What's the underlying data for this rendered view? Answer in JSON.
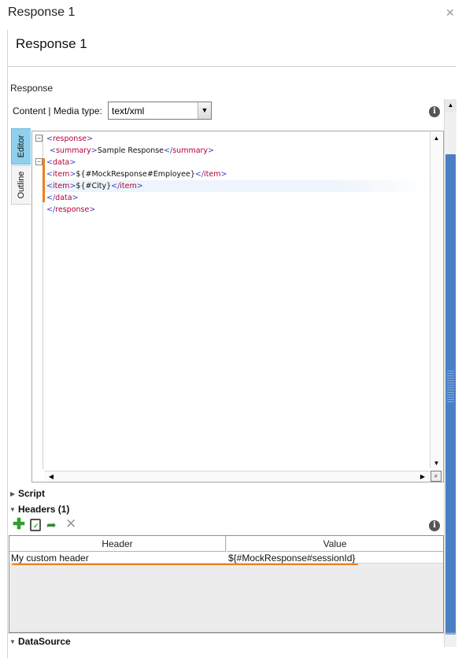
{
  "window": {
    "title": "Response 1"
  },
  "panel": {
    "heading": "Response 1",
    "section_label": "Response"
  },
  "media_type": {
    "label": "Content | Media type:",
    "value": "text/xml"
  },
  "tabs": [
    {
      "label": "Editor"
    },
    {
      "label": "Outline"
    }
  ],
  "editor": {
    "lines": [
      {
        "open": "<",
        "tag": "response",
        "close": ">"
      },
      {
        "open": "<",
        "tag": "summary",
        "close": ">",
        "text": "Sample Response",
        "end_open": "</",
        "end_tag": "summary",
        "end_close": ">"
      },
      {
        "open": "<",
        "tag": "data",
        "close": ">"
      },
      {
        "open": "<",
        "tag": "item",
        "close": ">",
        "text": "${#MockResponse#Employee}",
        "end_open": "</",
        "end_tag": "item",
        "end_close": ">"
      },
      {
        "open": "<",
        "tag": "item",
        "close": ">",
        "text": "${#City}",
        "end_open": "</",
        "end_tag": "item",
        "end_close": ">"
      },
      {
        "open": "</",
        "tag": "data",
        "close": ">"
      },
      {
        "open": "</",
        "tag": "response",
        "close": ">"
      }
    ]
  },
  "sections": {
    "script": "Script",
    "headers": "Headers (1)",
    "datasource": "DataSource"
  },
  "headers_table": {
    "columns": [
      "Header",
      "Value"
    ],
    "rows": [
      {
        "header": "My custom header",
        "value": "${#MockResponse#sessionId}"
      }
    ]
  },
  "colors": {
    "accent": "#f07d1a",
    "tab_active": "#8fd0ec",
    "scroll_thumb": "#4a7fc4",
    "add_green": "#2e9e2e"
  },
  "icons": {
    "close": "close-icon",
    "info": "info-icon",
    "add": "add-icon",
    "paste": "paste-icon",
    "export": "export-icon",
    "delete": "delete-icon"
  }
}
